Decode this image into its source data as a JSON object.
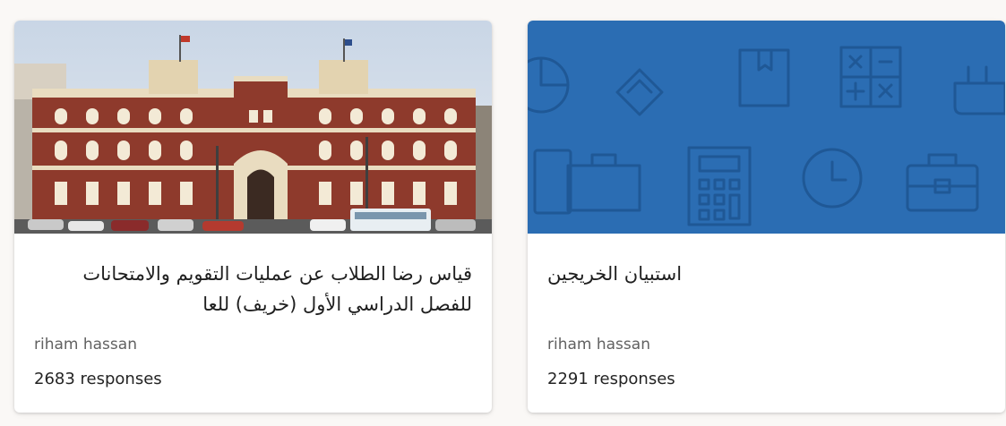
{
  "cards": [
    {
      "title": "قياس رضا الطلاب عن عمليات التقويم والامتحانات للفصل الدراسي الأول (خريف) للعا",
      "owner": "riham hassan",
      "responses": "2683 responses",
      "thumbnail": "university-building-photo"
    },
    {
      "title": "استبيان الخريجين",
      "owner": "riham hassan",
      "responses": "2291 responses",
      "thumbnail": "blue-pattern-icons",
      "thumbnail_color": "#2b6db3"
    }
  ]
}
